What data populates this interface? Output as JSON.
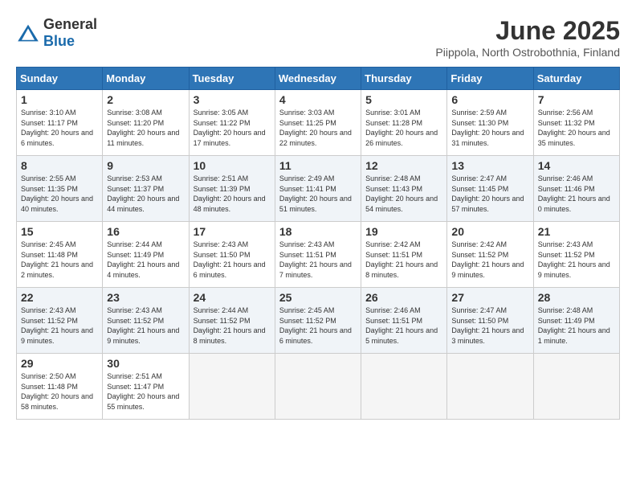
{
  "header": {
    "logo_general": "General",
    "logo_blue": "Blue",
    "month": "June 2025",
    "location": "Piippola, North Ostrobothnia, Finland"
  },
  "days_of_week": [
    "Sunday",
    "Monday",
    "Tuesday",
    "Wednesday",
    "Thursday",
    "Friday",
    "Saturday"
  ],
  "weeks": [
    [
      {
        "day": "1",
        "sunrise": "3:10 AM",
        "sunset": "11:17 PM",
        "daylight": "20 hours and 6 minutes."
      },
      {
        "day": "2",
        "sunrise": "3:08 AM",
        "sunset": "11:20 PM",
        "daylight": "20 hours and 11 minutes."
      },
      {
        "day": "3",
        "sunrise": "3:05 AM",
        "sunset": "11:22 PM",
        "daylight": "20 hours and 17 minutes."
      },
      {
        "day": "4",
        "sunrise": "3:03 AM",
        "sunset": "11:25 PM",
        "daylight": "20 hours and 22 minutes."
      },
      {
        "day": "5",
        "sunrise": "3:01 AM",
        "sunset": "11:28 PM",
        "daylight": "20 hours and 26 minutes."
      },
      {
        "day": "6",
        "sunrise": "2:59 AM",
        "sunset": "11:30 PM",
        "daylight": "20 hours and 31 minutes."
      },
      {
        "day": "7",
        "sunrise": "2:56 AM",
        "sunset": "11:32 PM",
        "daylight": "20 hours and 35 minutes."
      }
    ],
    [
      {
        "day": "8",
        "sunrise": "2:55 AM",
        "sunset": "11:35 PM",
        "daylight": "20 hours and 40 minutes."
      },
      {
        "day": "9",
        "sunrise": "2:53 AM",
        "sunset": "11:37 PM",
        "daylight": "20 hours and 44 minutes."
      },
      {
        "day": "10",
        "sunrise": "2:51 AM",
        "sunset": "11:39 PM",
        "daylight": "20 hours and 48 minutes."
      },
      {
        "day": "11",
        "sunrise": "2:49 AM",
        "sunset": "11:41 PM",
        "daylight": "20 hours and 51 minutes."
      },
      {
        "day": "12",
        "sunrise": "2:48 AM",
        "sunset": "11:43 PM",
        "daylight": "20 hours and 54 minutes."
      },
      {
        "day": "13",
        "sunrise": "2:47 AM",
        "sunset": "11:45 PM",
        "daylight": "20 hours and 57 minutes."
      },
      {
        "day": "14",
        "sunrise": "2:46 AM",
        "sunset": "11:46 PM",
        "daylight": "21 hours and 0 minutes."
      }
    ],
    [
      {
        "day": "15",
        "sunrise": "2:45 AM",
        "sunset": "11:48 PM",
        "daylight": "21 hours and 2 minutes."
      },
      {
        "day": "16",
        "sunrise": "2:44 AM",
        "sunset": "11:49 PM",
        "daylight": "21 hours and 4 minutes."
      },
      {
        "day": "17",
        "sunrise": "2:43 AM",
        "sunset": "11:50 PM",
        "daylight": "21 hours and 6 minutes."
      },
      {
        "day": "18",
        "sunrise": "2:43 AM",
        "sunset": "11:51 PM",
        "daylight": "21 hours and 7 minutes."
      },
      {
        "day": "19",
        "sunrise": "2:42 AM",
        "sunset": "11:51 PM",
        "daylight": "21 hours and 8 minutes."
      },
      {
        "day": "20",
        "sunrise": "2:42 AM",
        "sunset": "11:52 PM",
        "daylight": "21 hours and 9 minutes."
      },
      {
        "day": "21",
        "sunrise": "2:43 AM",
        "sunset": "11:52 PM",
        "daylight": "21 hours and 9 minutes."
      }
    ],
    [
      {
        "day": "22",
        "sunrise": "2:43 AM",
        "sunset": "11:52 PM",
        "daylight": "21 hours and 9 minutes."
      },
      {
        "day": "23",
        "sunrise": "2:43 AM",
        "sunset": "11:52 PM",
        "daylight": "21 hours and 9 minutes."
      },
      {
        "day": "24",
        "sunrise": "2:44 AM",
        "sunset": "11:52 PM",
        "daylight": "21 hours and 8 minutes."
      },
      {
        "day": "25",
        "sunrise": "2:45 AM",
        "sunset": "11:52 PM",
        "daylight": "21 hours and 6 minutes."
      },
      {
        "day": "26",
        "sunrise": "2:46 AM",
        "sunset": "11:51 PM",
        "daylight": "21 hours and 5 minutes."
      },
      {
        "day": "27",
        "sunrise": "2:47 AM",
        "sunset": "11:50 PM",
        "daylight": "21 hours and 3 minutes."
      },
      {
        "day": "28",
        "sunrise": "2:48 AM",
        "sunset": "11:49 PM",
        "daylight": "21 hours and 1 minute."
      }
    ],
    [
      {
        "day": "29",
        "sunrise": "2:50 AM",
        "sunset": "11:48 PM",
        "daylight": "20 hours and 58 minutes."
      },
      {
        "day": "30",
        "sunrise": "2:51 AM",
        "sunset": "11:47 PM",
        "daylight": "20 hours and 55 minutes."
      },
      null,
      null,
      null,
      null,
      null
    ]
  ]
}
